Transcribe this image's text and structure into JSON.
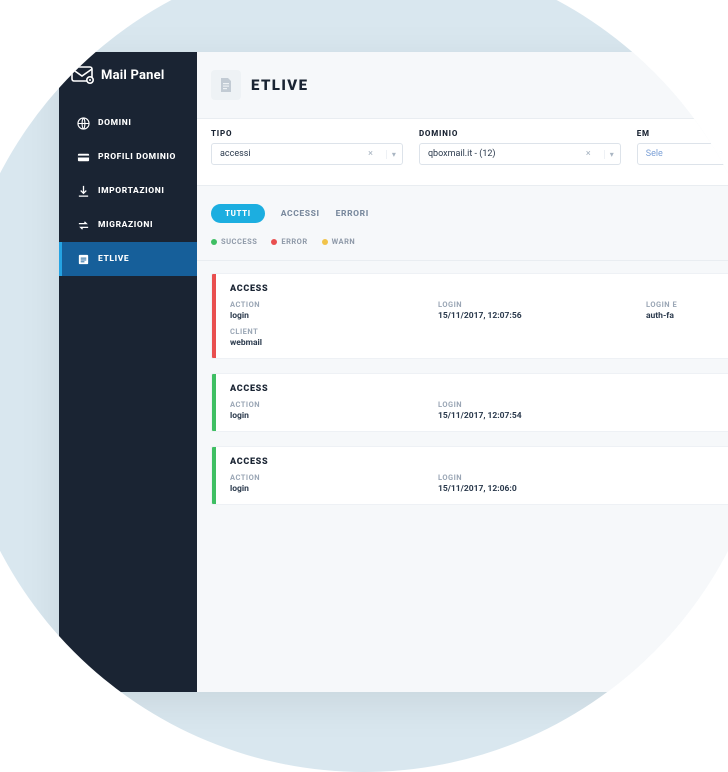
{
  "brand": {
    "label": "Mail Panel"
  },
  "sidebar": {
    "items": [
      {
        "label": "DOMINI",
        "icon": "globe-icon"
      },
      {
        "label": "PROFILI DOMINIO",
        "icon": "card-icon"
      },
      {
        "label": "IMPORTAZIONI",
        "icon": "import-icon"
      },
      {
        "label": "MIGRAZIONI",
        "icon": "migrate-icon"
      },
      {
        "label": "ETLIVE",
        "icon": "live-icon"
      }
    ]
  },
  "page": {
    "title": "ETLIVE"
  },
  "filters": {
    "tipo": {
      "label": "TIPO",
      "value": "accessi"
    },
    "dominio": {
      "label": "DOMINIO",
      "value": "qboxmail.it - (12)"
    },
    "em": {
      "label": "EM",
      "placeholder": "Sele"
    }
  },
  "tabs": {
    "all": "TUTTI",
    "accessi": "ACCESSI",
    "errori": "ERRORI"
  },
  "legend": {
    "success": "SUCCESS",
    "error": "ERROR",
    "warn": "WARN"
  },
  "labels": {
    "action": "ACTION",
    "login_time": "LOGIN",
    "login_extra": "LOGIN E",
    "client": "CLIENT"
  },
  "logs": [
    {
      "status": "red",
      "title": "ACCESS",
      "action": "login",
      "login_time": "15/11/2017, 12:07:56",
      "login_extra": "auth-fa",
      "client": "webmail"
    },
    {
      "status": "green",
      "title": "ACCESS",
      "action": "login",
      "login_time": "15/11/2017, 12:07:54",
      "login_extra": "",
      "client": ""
    },
    {
      "status": "green",
      "title": "ACCESS",
      "action": "login",
      "login_time": "15/11/2017, 12:06:0",
      "login_extra": "",
      "client": ""
    }
  ]
}
